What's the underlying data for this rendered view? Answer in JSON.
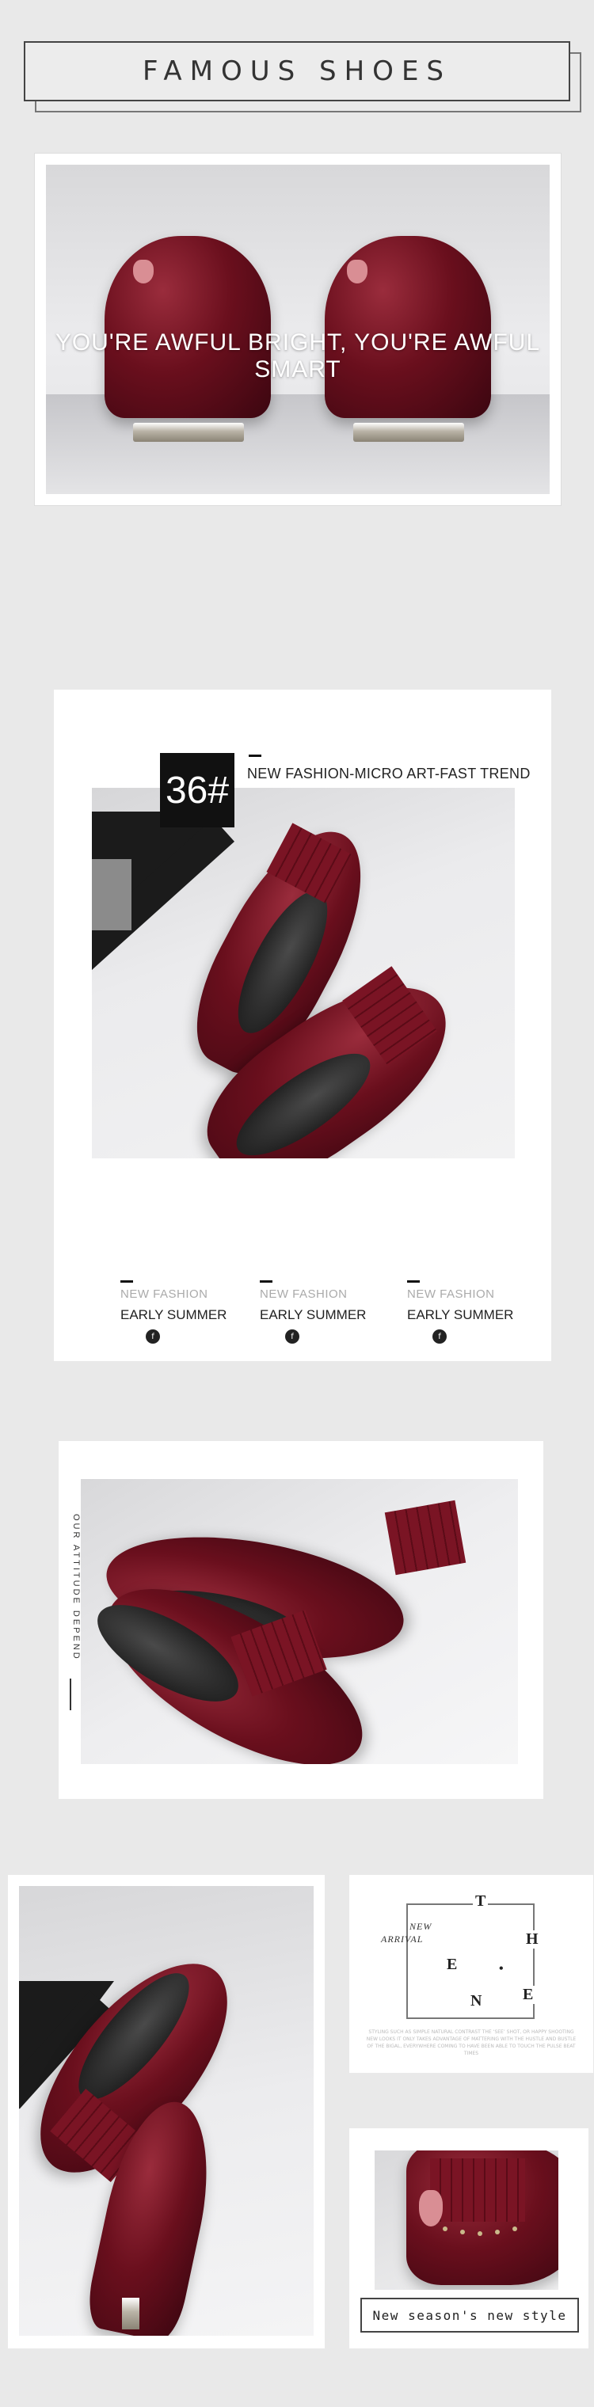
{
  "header": {
    "title": "FAMOUS SHOES"
  },
  "banner": {
    "slogan": "YOU'RE AWFUL BRIGHT, YOU'RE AWFUL SMART"
  },
  "card2": {
    "size_badge": "36#",
    "tagline": "NEW FASHION-MICRO ART-FAST TREND",
    "columns": [
      {
        "label1": "NEW FASHION",
        "label2": "EARLY SUMMER",
        "icon": "f"
      },
      {
        "label1": "NEW FASHION",
        "label2": "EARLY SUMMER",
        "icon": "f"
      },
      {
        "label1": "NEW FASHION",
        "label2": "EARLY SUMMER",
        "icon": "f"
      }
    ]
  },
  "card3": {
    "vertical_text": "OUR ATTITUDE DEPEND"
  },
  "card5": {
    "new_label": "NEW",
    "arrival_label": "ARRIVAL",
    "letters": {
      "t": "T",
      "h": "H",
      "e1": "E",
      "dot": "•",
      "n": "N",
      "e2": "E"
    },
    "description": "STYLING SUCH AS SIMPLE NATURAL CONTRAST THE ‘SEE’ SHOT, OR HAPPY SHOOTING NEW LOOKS IT ONLY TAKES ADVANTAGE OF MATTERING WITH THE HUSTLE AND BUSTLE OF THE BIGAL, EVERYWHERE COMING TO HAVE BEEN ABLE TO TOUCH THE PULSE BEAT TIMES"
  },
  "card6": {
    "footer": "New season's new style"
  },
  "colors": {
    "background": "#e9e9e9",
    "shoe": "#6a0f1d",
    "accent": "#111111"
  }
}
